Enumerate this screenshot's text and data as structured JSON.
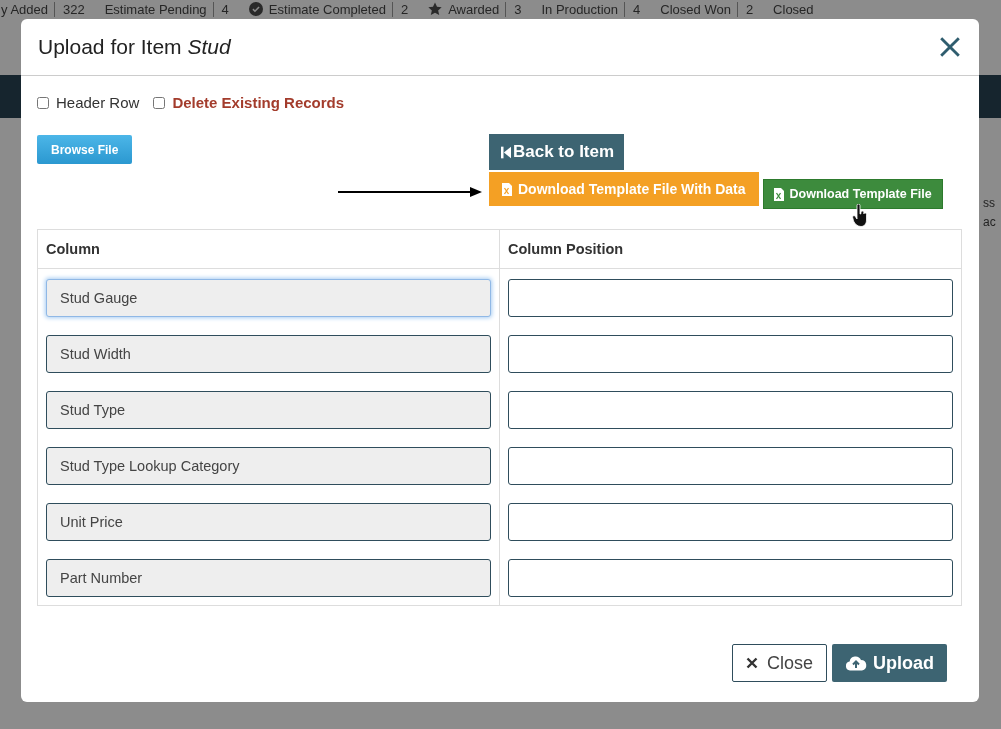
{
  "background": {
    "status_counts": [
      {
        "label": "y Added",
        "count": "322",
        "kind": "plain"
      },
      {
        "label": "Estimate Pending",
        "count": "4",
        "kind": "plain"
      },
      {
        "label": "Estimate Completed",
        "count": "2",
        "kind": "completed"
      },
      {
        "label": "Awarded",
        "count": "3",
        "kind": "awarded"
      },
      {
        "label": "In Production",
        "count": "4",
        "kind": "plain"
      },
      {
        "label": "Closed Won",
        "count": "2",
        "kind": "plain"
      },
      {
        "label": "Closed",
        "kind": "plain"
      }
    ],
    "side_texts": [
      "ss",
      "ac"
    ]
  },
  "modal": {
    "title": "Upload for Item *Stud*",
    "options": [
      {
        "label": "Header Row",
        "checked": false,
        "kind": "plain"
      },
      {
        "label": "Delete Existing Records",
        "checked": false,
        "kind": "danger"
      }
    ],
    "browse_button": "Browse File",
    "back_button": "Back to Item",
    "download_buttons": [
      {
        "label": "Download Template File With Data",
        "kind": "primary"
      },
      {
        "label": "Download Template File",
        "kind": "secondary"
      }
    ],
    "table": {
      "columns": [
        "Column",
        "Column Position"
      ],
      "rows": [
        {
          "column": "Stud Gauge",
          "focused": true
        },
        {
          "column": "Stud Width",
          "focused": false
        },
        {
          "column": "Stud Type",
          "focused": false
        },
        {
          "column": "Stud Type Lookup Category",
          "focused": false
        },
        {
          "column": "Unit Price",
          "focused": false
        },
        {
          "column": "Part Number",
          "focused": false
        }
      ]
    },
    "footer_buttons": [
      {
        "label": "Close",
        "kind": "close"
      },
      {
        "label": "Upload",
        "kind": "upload"
      }
    ]
  }
}
